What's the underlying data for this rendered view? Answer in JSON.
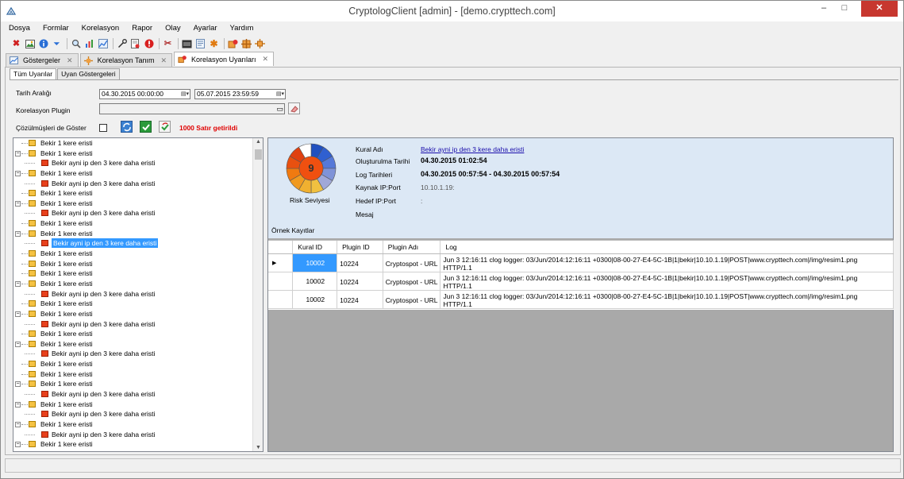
{
  "window": {
    "title": "CryptologClient [admin] - [demo.crypttech.com]",
    "minimize": "–",
    "maximize": "□",
    "close": "✕"
  },
  "menu": [
    "Dosya",
    "Formlar",
    "Korelasyon",
    "Rapor",
    "Olay",
    "Ayarlar",
    "Yardım"
  ],
  "toolbar_icons": [
    "delete-icon",
    "image-icon",
    "info-icon",
    "dropdown-icon",
    "search-icon",
    "chart-icon",
    "trend-icon",
    "key-icon",
    "report-icon",
    "alert-icon",
    "tools-icon",
    "cpu-icon",
    "document-icon",
    "gear-icon",
    "plugin-icon",
    "plugin-add-icon",
    "plugin-settings-icon"
  ],
  "doc_tabs": [
    {
      "label": "Göstergeler",
      "close": "✕"
    },
    {
      "label": "Korelasyon Tanım",
      "close": "✕"
    },
    {
      "label": "Korelasyon Uyarıları",
      "close": "✕"
    }
  ],
  "inner_tabs": [
    "Tüm Uyarılar",
    "Uyan Göstergeleri"
  ],
  "filters": {
    "date_range_label": "Tarih Aralığı",
    "date_start": "04.30.2015 00:00:00",
    "date_end": "05.07.2015 23:59:59",
    "plugin_label": "Korelasyon Plugin",
    "plugin_value": "",
    "show_resolved_label": "Çözülmüşleri de Göster",
    "show_resolved_checked": false,
    "result_text": "1000 Satır getirildi"
  },
  "tree": {
    "items": [
      {
        "label": "Bekir 1 kere eristi",
        "level": 0,
        "expander": "",
        "icon": "yellow"
      },
      {
        "label": "Bekir 1 kere eristi",
        "level": 0,
        "expander": "−",
        "icon": "yellow"
      },
      {
        "label": "Bekir ayni ip den 3 kere daha eristi",
        "level": 1,
        "expander": "",
        "icon": "red"
      },
      {
        "label": "Bekir 1 kere eristi",
        "level": 0,
        "expander": "−",
        "icon": "yellow"
      },
      {
        "label": "Bekir ayni ip den 3 kere daha eristi",
        "level": 1,
        "expander": "",
        "icon": "red"
      },
      {
        "label": "Bekir 1 kere eristi",
        "level": 0,
        "expander": "",
        "icon": "yellow"
      },
      {
        "label": "Bekir 1 kere eristi",
        "level": 0,
        "expander": "−",
        "icon": "yellow"
      },
      {
        "label": "Bekir ayni ip den 3 kere daha eristi",
        "level": 1,
        "expander": "",
        "icon": "red"
      },
      {
        "label": "Bekir 1 kere eristi",
        "level": 0,
        "expander": "",
        "icon": "yellow"
      },
      {
        "label": "Bekir 1 kere eristi",
        "level": 0,
        "expander": "−",
        "icon": "yellow"
      },
      {
        "label": "Bekir ayni ip den 3 kere daha eristi",
        "level": 1,
        "expander": "",
        "icon": "red",
        "selected": true
      },
      {
        "label": "Bekir 1 kere eristi",
        "level": 0,
        "expander": "",
        "icon": "yellow"
      },
      {
        "label": "Bekir 1 kere eristi",
        "level": 0,
        "expander": "",
        "icon": "yellow"
      },
      {
        "label": "Bekir 1 kere eristi",
        "level": 0,
        "expander": "",
        "icon": "yellow"
      },
      {
        "label": "Bekir 1 kere eristi",
        "level": 0,
        "expander": "−",
        "icon": "yellow"
      },
      {
        "label": "Bekir ayni ip den 3 kere daha eristi",
        "level": 1,
        "expander": "",
        "icon": "red"
      },
      {
        "label": "Bekir 1 kere eristi",
        "level": 0,
        "expander": "",
        "icon": "yellow"
      },
      {
        "label": "Bekir 1 kere eristi",
        "level": 0,
        "expander": "−",
        "icon": "yellow"
      },
      {
        "label": "Bekir ayni ip den 3 kere daha eristi",
        "level": 1,
        "expander": "",
        "icon": "red"
      },
      {
        "label": "Bekir 1 kere eristi",
        "level": 0,
        "expander": "",
        "icon": "yellow"
      },
      {
        "label": "Bekir 1 kere eristi",
        "level": 0,
        "expander": "−",
        "icon": "yellow"
      },
      {
        "label": "Bekir ayni ip den 3 kere daha eristi",
        "level": 1,
        "expander": "",
        "icon": "red"
      },
      {
        "label": "Bekir 1 kere eristi",
        "level": 0,
        "expander": "",
        "icon": "yellow"
      },
      {
        "label": "Bekir 1 kere eristi",
        "level": 0,
        "expander": "",
        "icon": "yellow"
      },
      {
        "label": "Bekir 1 kere eristi",
        "level": 0,
        "expander": "−",
        "icon": "yellow"
      },
      {
        "label": "Bekir ayni ip den 3 kere daha eristi",
        "level": 1,
        "expander": "",
        "icon": "red"
      },
      {
        "label": "Bekir 1 kere eristi",
        "level": 0,
        "expander": "−",
        "icon": "yellow"
      },
      {
        "label": "Bekir ayni ip den 3 kere daha eristi",
        "level": 1,
        "expander": "",
        "icon": "red"
      },
      {
        "label": "Bekir 1 kere eristi",
        "level": 0,
        "expander": "−",
        "icon": "yellow"
      },
      {
        "label": "Bekir ayni ip den 3 kere daha eristi",
        "level": 1,
        "expander": "",
        "icon": "red"
      },
      {
        "label": "Bekir 1 kere eristi",
        "level": 0,
        "expander": "−",
        "icon": "yellow"
      },
      {
        "label": "Bekir ayni ip den 3 kere daha eristi",
        "level": 1,
        "expander": "",
        "icon": "red"
      }
    ]
  },
  "detail": {
    "risk_value": "9",
    "risk_label": "Risk Seviyesi",
    "fields": [
      {
        "label": "Kural Adı",
        "value": "Bekir ayni ip den 3 kere daha eristi",
        "style": "link"
      },
      {
        "label": "Oluşturulma Tarihi",
        "value": "04.30.2015 01:02:54",
        "style": "bold"
      },
      {
        "label": "Log Tarihleri",
        "value": "04.30.2015 00:57:54  -  04.30.2015 00:57:54",
        "style": "bold"
      },
      {
        "label": "Kaynak IP:Port",
        "value": "10.10.1.19:",
        "style": "gray"
      },
      {
        "label": "Hedef IP:Port",
        "value": ":",
        "style": "gray"
      },
      {
        "label": "Mesaj",
        "value": "",
        "style": "gray"
      }
    ],
    "samples_label": "Örnek Kayıtlar",
    "grid": {
      "columns": [
        "Kural ID",
        "Plugin ID",
        "Plugin Adı",
        "Log"
      ],
      "rows": [
        {
          "marker": "▶",
          "kural_id": "10002",
          "plugin_id": "10224",
          "plugin_name": "Cryptospot - URL",
          "log1": "Jun  3 12:16:11 clog logger: 03/Jun/2014:12:16:11 +0300|08-00-27-E4-5C-1B|1|bekir|10.10.1.19|POST|www.crypttech.com|/img/resim1.png",
          "log2": "HTTP/1.1"
        },
        {
          "marker": "",
          "kural_id": "10002",
          "plugin_id": "10224",
          "plugin_name": "Cryptospot - URL",
          "log1": "Jun  3 12:16:11 clog logger: 03/Jun/2014:12:16:11 +0300|08-00-27-E4-5C-1B|1|bekir|10.10.1.19|POST|www.crypttech.com|/img/resim1.png",
          "log2": "HTTP/1.1"
        },
        {
          "marker": "",
          "kural_id": "10002",
          "plugin_id": "10224",
          "plugin_name": "Cryptospot - URL",
          "log1": "Jun  3 12:16:11 clog logger: 03/Jun/2014:12:16:11 +0300|08-00-27-E4-5C-1B|1|bekir|10.10.1.19|POST|www.crypttech.com|/img/resim1.png",
          "log2": "HTTP/1.1"
        }
      ]
    }
  },
  "colors": {
    "close_button": "#c7372f",
    "selection": "#3399ff",
    "detail_background": "#dce8f5",
    "result_text": "#e00000",
    "tree_yellow": "#f5c242",
    "tree_red": "#e8401c"
  }
}
